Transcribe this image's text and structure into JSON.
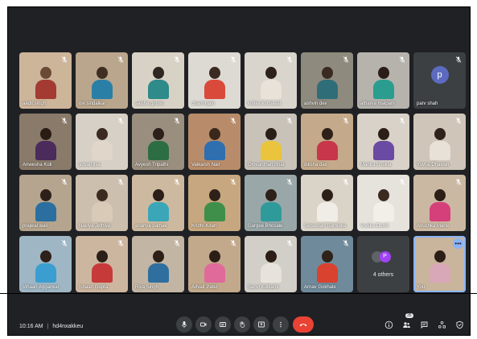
{
  "meeting": {
    "time": "10:16 AM",
    "code": "hd4nxakkeu"
  },
  "participants": [
    {
      "name": "aadit singh",
      "bg": "#cdb59a",
      "accent": "#6b4a35",
      "shirt": "#a33b32"
    },
    {
      "name": "ovi sindalkar",
      "bg": "#b9a68c",
      "accent": "#3f2e22",
      "shirt": "#2a7fa6"
    },
    {
      "name": "saisha ghosh",
      "bg": "#d8d2c6",
      "accent": "#2e2620",
      "shirt": "#2f8a8a"
    },
    {
      "name": "charmi jain",
      "bg": "#ddd9d3",
      "accent": "#3b2a20",
      "shirt": "#d94a3a"
    },
    {
      "name": "kritika kumawat",
      "bg": "#d9d4cc",
      "accent": "#2d211a",
      "shirt": "#e9e2d8"
    },
    {
      "name": "ashvin dev",
      "bg": "#8f8a7e",
      "accent": "#3a2a20",
      "shirt": "#2f6e78"
    },
    {
      "name": "atharva malpani",
      "bg": "#b6b3ad",
      "accent": "#2a1e17",
      "shirt": "#2a9d8f"
    },
    {
      "name": "parv shah",
      "bg": "#3c4043",
      "avatar_letter": "p",
      "avatar_color": "#5c6bc0"
    },
    {
      "name": "Anwesha Koli",
      "bg": "#8a7a6a",
      "accent": "#2a1c15",
      "shirt": "#4a2b5c"
    },
    {
      "name": "advait jiva",
      "bg": "#d6d0c6",
      "accent": "#3a2a22",
      "shirt": "#e0d6c9"
    },
    {
      "name": "Avyesh Tripathi",
      "bg": "#9a8f7f",
      "accent": "#2c2119",
      "shirt": "#2d6d44"
    },
    {
      "name": "Vaikarsh Nair",
      "bg": "#b88c6a",
      "accent": "#3b281d",
      "shirt": "#2f6fb0"
    },
    {
      "name": "Omvardhan Bhat",
      "bg": "#c8c2b8",
      "accent": "#2a1f18",
      "shirt": "#e9c43c"
    },
    {
      "name": "diksha das",
      "bg": "#c4a98a",
      "accent": "#2e2019",
      "shirt": "#c7364a"
    },
    {
      "name": "Mahira Shukla",
      "bg": "#d8d2c8",
      "accent": "#2b1f18",
      "shirt": "#6b4aa3"
    },
    {
      "name": "Yuvraj Dhawan",
      "bg": "#cfc5b8",
      "accent": "#2f221a",
      "shirt": "#e8e1d7"
    },
    {
      "name": "prajwal wali",
      "bg": "#b5a48e",
      "accent": "#2c2019",
      "shirt": "#2b6fa0"
    },
    {
      "name": "Naviya Jethwa",
      "bg": "#cdbfae",
      "accent": "#3a2a20",
      "shirt": "#d9cab8"
    },
    {
      "name": "ananya pathak",
      "bg": "#cdb99f",
      "accent": "#2a1e17",
      "shirt": "#3aa6b8"
    },
    {
      "name": "Kruthi Kiran",
      "bg": "#c7a77f",
      "accent": "#2e2119",
      "shirt": "#3f8f4a"
    },
    {
      "name": "Gargee Bhosale",
      "bg": "#9aa7a8",
      "accent": "#2d211a",
      "shirt": "#2f9a9a"
    },
    {
      "name": "Sebastian Ramteke",
      "bg": "#d9d3c8",
      "accent": "#2c1f18",
      "shirt": "#f0ece6"
    },
    {
      "name": "Vedika Doshi",
      "bg": "#e6e2dc",
      "accent": "#3a2a20",
      "shirt": "#f2efe9"
    },
    {
      "name": "Anushka Mane",
      "bg": "#cbb8a2",
      "accent": "#2b1e17",
      "shirt": "#d6407a"
    },
    {
      "name": "Vihaan Aggarwal",
      "bg": "#9fb6c4",
      "accent": "#2e2119",
      "shirt": "#3a9ed0"
    },
    {
      "name": "Ishaan Gupta",
      "bg": "#cdb6a0",
      "accent": "#2b1f18",
      "shirt": "#c63a3a"
    },
    {
      "name": "Riya Singh",
      "bg": "#c3b5a3",
      "accent": "#2c1f18",
      "shirt": "#2f6fa0"
    },
    {
      "name": "Advait Patel",
      "bg": "#c2a98c",
      "accent": "#2b1e17",
      "shirt": "#e06a9a"
    },
    {
      "name": "Sanvi Kulkarni",
      "bg": "#d2cec8",
      "accent": "#2a1e17",
      "shirt": "#e7e2da"
    },
    {
      "name": "Arnav Gokhale",
      "bg": "#6f8a9a",
      "accent": "#2f2219",
      "shirt": "#d8422e"
    }
  ],
  "others_tile": {
    "label": "4 others",
    "dot_letter": "P"
  },
  "self_tile": {
    "name": "You",
    "bg": "#c9b49c",
    "accent": "#2b1e17",
    "shirt": "#d8a8b8",
    "more_glyph": "•••"
  },
  "controls": {
    "icons": [
      "mic-icon",
      "camera-icon",
      "captions-icon",
      "raise-hand-icon",
      "present-icon",
      "more-options-icon"
    ],
    "end_call": "end-call-icon"
  },
  "right_controls": {
    "participant_count": "35",
    "icons": [
      "info-icon",
      "people-icon",
      "chat-icon",
      "activities-icon",
      "host-controls-icon"
    ]
  },
  "colors": {
    "background": "#202124",
    "accent_blue": "#8ab4f8",
    "end_call_red": "#ea4335",
    "text": "#e8eaed"
  }
}
